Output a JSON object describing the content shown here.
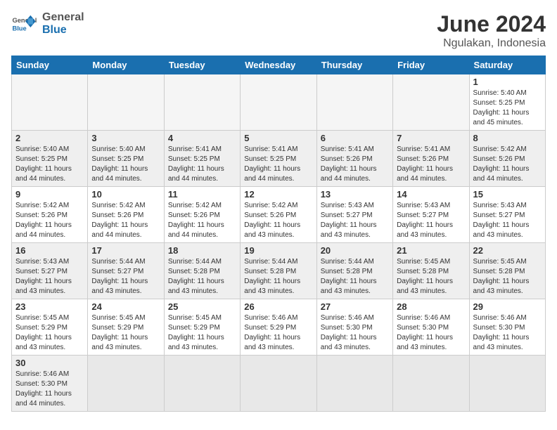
{
  "header": {
    "logo_general": "General",
    "logo_blue": "Blue",
    "month_title": "June 2024",
    "location": "Ngulakan, Indonesia"
  },
  "days_of_week": [
    "Sunday",
    "Monday",
    "Tuesday",
    "Wednesday",
    "Thursday",
    "Friday",
    "Saturday"
  ],
  "weeks": [
    [
      {
        "day": "",
        "info": ""
      },
      {
        "day": "",
        "info": ""
      },
      {
        "day": "",
        "info": ""
      },
      {
        "day": "",
        "info": ""
      },
      {
        "day": "",
        "info": ""
      },
      {
        "day": "",
        "info": ""
      },
      {
        "day": "1",
        "info": "Sunrise: 5:40 AM\nSunset: 5:25 PM\nDaylight: 11 hours\nand 45 minutes."
      }
    ],
    [
      {
        "day": "2",
        "info": "Sunrise: 5:40 AM\nSunset: 5:25 PM\nDaylight: 11 hours\nand 44 minutes."
      },
      {
        "day": "3",
        "info": "Sunrise: 5:40 AM\nSunset: 5:25 PM\nDaylight: 11 hours\nand 44 minutes."
      },
      {
        "day": "4",
        "info": "Sunrise: 5:41 AM\nSunset: 5:25 PM\nDaylight: 11 hours\nand 44 minutes."
      },
      {
        "day": "5",
        "info": "Sunrise: 5:41 AM\nSunset: 5:25 PM\nDaylight: 11 hours\nand 44 minutes."
      },
      {
        "day": "6",
        "info": "Sunrise: 5:41 AM\nSunset: 5:26 PM\nDaylight: 11 hours\nand 44 minutes."
      },
      {
        "day": "7",
        "info": "Sunrise: 5:41 AM\nSunset: 5:26 PM\nDaylight: 11 hours\nand 44 minutes."
      },
      {
        "day": "8",
        "info": "Sunrise: 5:42 AM\nSunset: 5:26 PM\nDaylight: 11 hours\nand 44 minutes."
      }
    ],
    [
      {
        "day": "9",
        "info": "Sunrise: 5:42 AM\nSunset: 5:26 PM\nDaylight: 11 hours\nand 44 minutes."
      },
      {
        "day": "10",
        "info": "Sunrise: 5:42 AM\nSunset: 5:26 PM\nDaylight: 11 hours\nand 44 minutes."
      },
      {
        "day": "11",
        "info": "Sunrise: 5:42 AM\nSunset: 5:26 PM\nDaylight: 11 hours\nand 44 minutes."
      },
      {
        "day": "12",
        "info": "Sunrise: 5:42 AM\nSunset: 5:26 PM\nDaylight: 11 hours\nand 43 minutes."
      },
      {
        "day": "13",
        "info": "Sunrise: 5:43 AM\nSunset: 5:27 PM\nDaylight: 11 hours\nand 43 minutes."
      },
      {
        "day": "14",
        "info": "Sunrise: 5:43 AM\nSunset: 5:27 PM\nDaylight: 11 hours\nand 43 minutes."
      },
      {
        "day": "15",
        "info": "Sunrise: 5:43 AM\nSunset: 5:27 PM\nDaylight: 11 hours\nand 43 minutes."
      }
    ],
    [
      {
        "day": "16",
        "info": "Sunrise: 5:43 AM\nSunset: 5:27 PM\nDaylight: 11 hours\nand 43 minutes."
      },
      {
        "day": "17",
        "info": "Sunrise: 5:44 AM\nSunset: 5:27 PM\nDaylight: 11 hours\nand 43 minutes."
      },
      {
        "day": "18",
        "info": "Sunrise: 5:44 AM\nSunset: 5:28 PM\nDaylight: 11 hours\nand 43 minutes."
      },
      {
        "day": "19",
        "info": "Sunrise: 5:44 AM\nSunset: 5:28 PM\nDaylight: 11 hours\nand 43 minutes."
      },
      {
        "day": "20",
        "info": "Sunrise: 5:44 AM\nSunset: 5:28 PM\nDaylight: 11 hours\nand 43 minutes."
      },
      {
        "day": "21",
        "info": "Sunrise: 5:45 AM\nSunset: 5:28 PM\nDaylight: 11 hours\nand 43 minutes."
      },
      {
        "day": "22",
        "info": "Sunrise: 5:45 AM\nSunset: 5:28 PM\nDaylight: 11 hours\nand 43 minutes."
      }
    ],
    [
      {
        "day": "23",
        "info": "Sunrise: 5:45 AM\nSunset: 5:29 PM\nDaylight: 11 hours\nand 43 minutes."
      },
      {
        "day": "24",
        "info": "Sunrise: 5:45 AM\nSunset: 5:29 PM\nDaylight: 11 hours\nand 43 minutes."
      },
      {
        "day": "25",
        "info": "Sunrise: 5:45 AM\nSunset: 5:29 PM\nDaylight: 11 hours\nand 43 minutes."
      },
      {
        "day": "26",
        "info": "Sunrise: 5:46 AM\nSunset: 5:29 PM\nDaylight: 11 hours\nand 43 minutes."
      },
      {
        "day": "27",
        "info": "Sunrise: 5:46 AM\nSunset: 5:30 PM\nDaylight: 11 hours\nand 43 minutes."
      },
      {
        "day": "28",
        "info": "Sunrise: 5:46 AM\nSunset: 5:30 PM\nDaylight: 11 hours\nand 43 minutes."
      },
      {
        "day": "29",
        "info": "Sunrise: 5:46 AM\nSunset: 5:30 PM\nDaylight: 11 hours\nand 43 minutes."
      }
    ],
    [
      {
        "day": "30",
        "info": "Sunrise: 5:46 AM\nSunset: 5:30 PM\nDaylight: 11 hours\nand 44 minutes."
      },
      {
        "day": "",
        "info": ""
      },
      {
        "day": "",
        "info": ""
      },
      {
        "day": "",
        "info": ""
      },
      {
        "day": "",
        "info": ""
      },
      {
        "day": "",
        "info": ""
      },
      {
        "day": "",
        "info": ""
      }
    ]
  ]
}
